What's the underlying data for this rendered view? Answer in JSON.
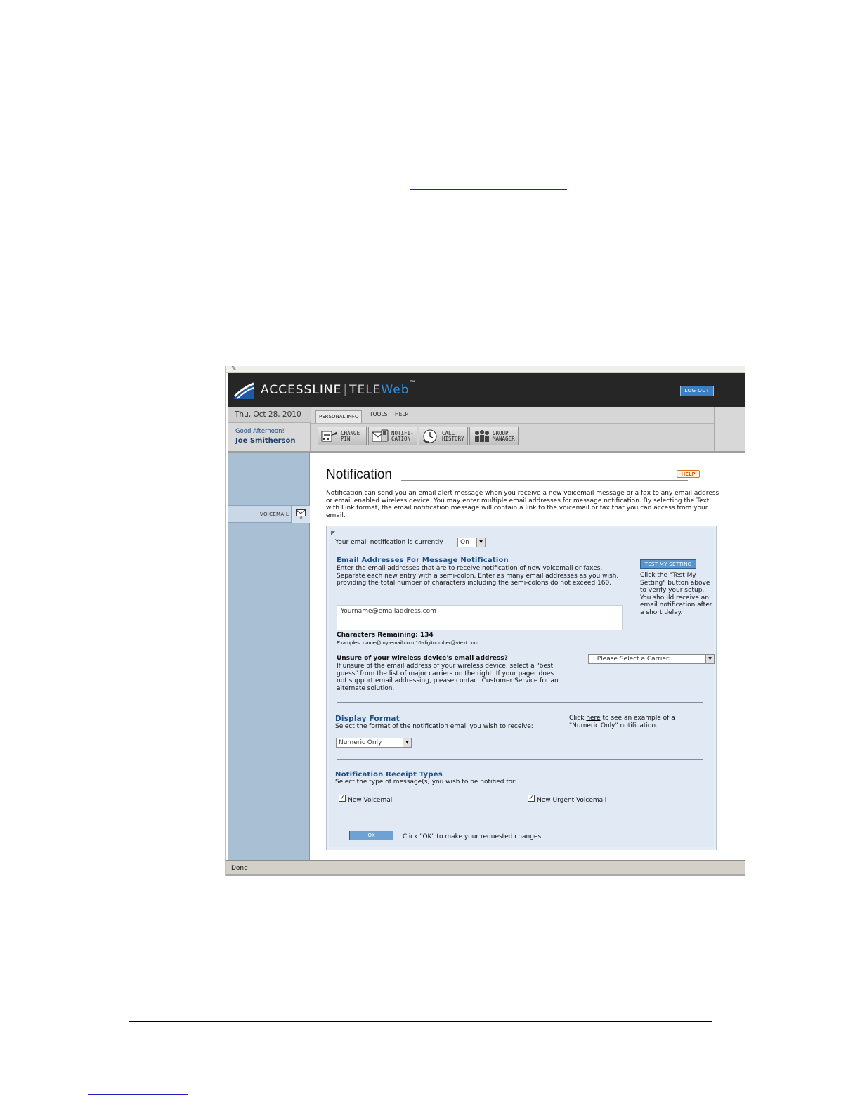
{
  "app": {
    "brand_main": "ACCESSLINE",
    "brand_tele": "TELE",
    "brand_web": "Web",
    "brand_tm": "™",
    "logout_label": "LOG OUT"
  },
  "user": {
    "date": "Thu, Oct 28, 2010",
    "greeting": "Good Afternoon!",
    "name": "Joe Smitherson"
  },
  "tabs": [
    {
      "label": "PERSONAL INFO",
      "active": true
    },
    {
      "label": "TOOLS",
      "active": false
    },
    {
      "label": "HELP",
      "active": false
    }
  ],
  "toolbar": [
    {
      "label": "CHANGE\nPIN",
      "icon": "change-pin-icon"
    },
    {
      "label": "NOTIFI-\nCATION",
      "icon": "notification-icon"
    },
    {
      "label": "CALL\nHISTORY",
      "icon": "call-history-icon"
    },
    {
      "label": "GROUP\nMANAGER",
      "icon": "group-manager-icon"
    }
  ],
  "sidebar": {
    "voicemail_label": "VOICEMAIL",
    "voicemail_count": "0",
    "voicemail_icon": "envelope-icon"
  },
  "page": {
    "title": "Notification",
    "help_label": "HELP",
    "intro": "Notification can send you an email alert message when you receive a new voicemail message or a fax to any email address or email enabled wireless device. You may enter multiple email addresses for message notification. By selecting the Text with Link format, the email notification message will contain a link to the voicemail or fax that you can access from your email."
  },
  "form": {
    "status_label": "Your email notification is currently",
    "status_value": "On",
    "email_heading": "Email Addresses For Message Notification",
    "email_desc": "Enter the email addresses that are to receive notification of new voicemail or faxes. Separate each new entry with a semi-colon. Enter as many email addresses as you wish, providing the total number of characters including the semi-colons do not exceed 160.",
    "email_value": "Yourname@emailaddress.com",
    "test_button": "TEST MY SETTING",
    "test_desc": "Click the \"Test My Setting\" button above to verify your setup. You should receive an email notification after a short delay.",
    "chars_label": "Characters Remaining: 134",
    "examples": "Examples: name@my-email.com;10-digitnumber@vtext.com",
    "wireless_heading": "Unsure of your wireless device's email address?",
    "wireless_desc": "If unsure of the email address of your wireless device, select a \"best guess\" from the list of major carriers on the right. If your pager does not support email addressing, please contact Customer Service for an alternate solution.",
    "carrier_value": ".: Please Select a Carrier:.",
    "display_heading": "Display Format",
    "display_desc": "Select the format of the notification email you wish to receive:",
    "display_value": "Numeric Only",
    "example_pre": "Click ",
    "example_link": "here",
    "example_post": " to see an example of a",
    "example_line2": "\"Numeric Only\" notification.",
    "receipt_heading": "Notification Receipt Types",
    "receipt_desc": "Select the type of message(s) you wish to be notified for:",
    "cb_voicemail": "New Voicemail",
    "cb_urgent": "New Urgent Voicemail",
    "ok_button": "OK",
    "ok_desc": "Click \"OK\" to make your requested changes."
  },
  "statusbar": {
    "text": "Done"
  }
}
